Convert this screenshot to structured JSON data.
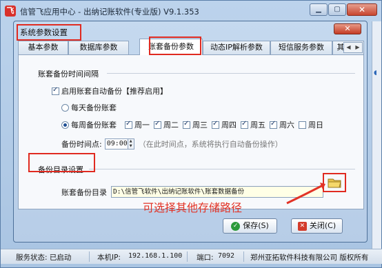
{
  "app": {
    "title": "信管飞应用中心 - 出纳记账软件(专业版) V9.1.353",
    "logo_text": "飞"
  },
  "window_controls": {
    "minimize": "▁",
    "maximize": "▢",
    "close": "✕"
  },
  "dialog": {
    "title": "系统参数设置",
    "close": "✕",
    "tabs": [
      {
        "label": "基本参数"
      },
      {
        "label": "数据库参数"
      },
      {
        "label": "账套备份参数"
      },
      {
        "label": "动态IP解析参数"
      },
      {
        "label": "短信服务参数"
      },
      {
        "label": "其他参"
      }
    ],
    "active_tab": "账套备份参数",
    "tab_scroll": {
      "left": "◀",
      "right": "▶"
    }
  },
  "backup_interval": {
    "section_label": "账套备份时间间隔",
    "auto_backup_label": "启用账套自动备份【推荐启用】",
    "auto_backup_checked": true,
    "daily_label": "每天备份账套",
    "weekly_label": "每周备份账套",
    "mode": "weekly",
    "days": [
      {
        "label": "周一",
        "checked": true
      },
      {
        "label": "周二",
        "checked": true
      },
      {
        "label": "周三",
        "checked": true
      },
      {
        "label": "周四",
        "checked": true
      },
      {
        "label": "周五",
        "checked": true
      },
      {
        "label": "周六",
        "checked": true
      },
      {
        "label": "周日",
        "checked": false
      }
    ],
    "time_label": "备份时间点:",
    "time_value": "09:00",
    "time_hint": "（在此时间点，系统将执行自动备份操作）"
  },
  "backup_dir": {
    "section_label": "备份目录设置",
    "dir_label": "账套备份目录",
    "dir_value": "D:\\信管飞软件\\出纳记账软件\\账套数据备份"
  },
  "annotation": "可选择其他存储路径",
  "buttons": {
    "save": "保存(S)",
    "close": "关闭(C)"
  },
  "status": {
    "service": "服务状态: 已启动",
    "local_ip_label": "本机IP:",
    "local_ip": "192.168.1.100",
    "port_label": "端口:",
    "port": "7092",
    "company": "郑州亚拓软件科技有限公司 版权所有"
  },
  "colors": {
    "highlight_red": "#e02a20",
    "titlebar_blue": "#bcd3ec",
    "save_green": "#2c9a3a"
  }
}
